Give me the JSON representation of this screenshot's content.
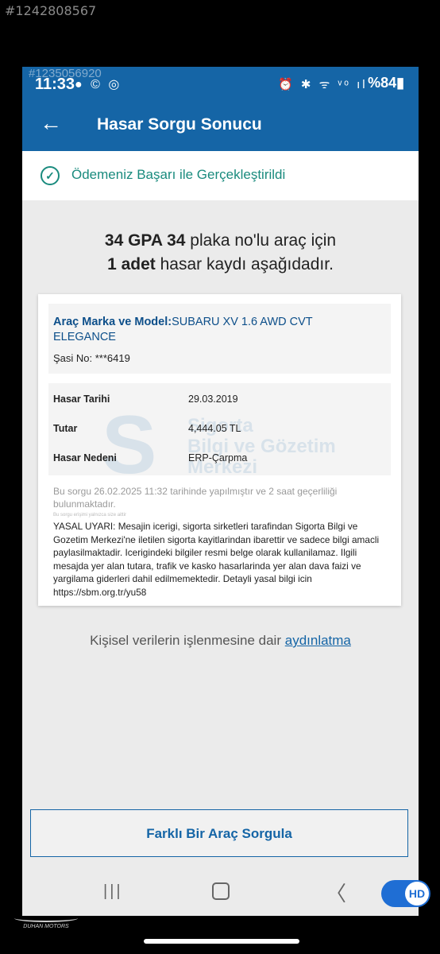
{
  "watermark": "#1242808567",
  "status": {
    "watermark2": "#1235056920",
    "time": "11:33",
    "left_icons": "● © ◎",
    "right_icons": "⏰ ✱ ᯤ ᵛᵒ ıl",
    "battery": "%84▮"
  },
  "appbar": {
    "back_icon": "←",
    "title": "Hasar Sorgu Sonucu"
  },
  "success": {
    "text": "Ödemeniz Başarı ile Gerçekleştirildi"
  },
  "headline": {
    "plate": "34 GPA 34",
    "line1_rest": " plaka no'lu araç için",
    "count": "1 adet",
    "line2_rest": " hasar kaydı aşağıdadır."
  },
  "vehicle": {
    "brand_label": "Araç Marka ve Model:",
    "brand_value": "SUBARU XV 1.6 AWD CVT ELEGANCE",
    "chassis_label": "Şasi No: ",
    "chassis_value": "***6419"
  },
  "damage": {
    "date_label": "Hasar Tarihi",
    "date_value": "29.03.2019",
    "amount_label": "Tutar",
    "amount_value": "4,444.05 TL",
    "reason_label": "Hasar Nedeni",
    "reason_value": "ERP-Çarpma"
  },
  "logo_watermark": {
    "letter": "S",
    "line1": "Sigorta",
    "line2": "Bilgi ve Gözetim",
    "line3": "Merkezi"
  },
  "query_info": "Bu sorgu 26.02.2025 11:32 tarihinde yapılmıştır ve 2 saat geçerliliği bulunmaktadır.",
  "small_garble": "Bu sorgu erişimi yalnızca size aittir",
  "legal": "YASAL UYARI: Mesajin icerigi, sigorta sirketleri tarafindan Sigorta Bilgi ve Gozetim Merkezi'ne iletilen sigorta kayitlarindan ibarettir ve sadece bilgi amacli paylasilmaktadir. Icerigindeki bilgiler resmi belge olarak kullanilamaz. Ilgili mesajda yer alan tutara, trafik ve kasko hasarlarinda yer alan dava faizi ve yargilama giderleri dahil edilmemektedir. Detayli yasal bilgi icin https://sbm.org.tr/yu58",
  "privacy": {
    "text": "Kişisel verilerin işlenmesine dair ",
    "link": "aydınlatma"
  },
  "button": {
    "label": "Farklı Bir Araç Sorgula"
  },
  "navbar": {
    "recent_icon": "|||",
    "back_icon": "〈"
  },
  "hd_badge": "HD",
  "bottom_logo": "DUHAN MOTORS",
  "colors": {
    "primary": "#1565a6",
    "success": "#1a8b7e",
    "background": "#ebebeb"
  }
}
